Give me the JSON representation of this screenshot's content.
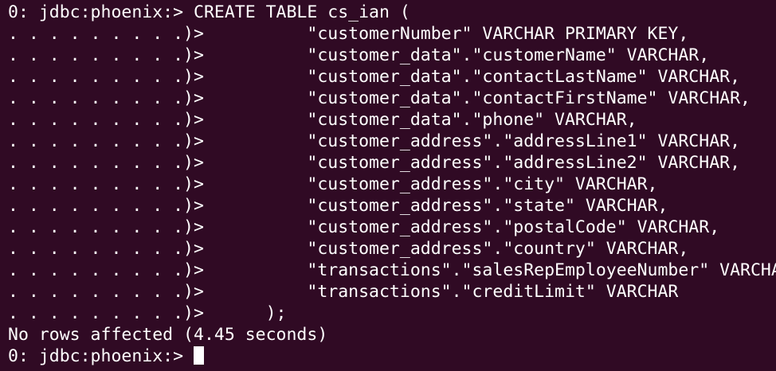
{
  "theme": {
    "background": "#300a24",
    "foreground": "#ffffff"
  },
  "terminal": {
    "lines": [
      "0: jdbc:phoenix:> CREATE TABLE cs_ian (",
      ". . . . . . . . .)>          \"customerNumber\" VARCHAR PRIMARY KEY,",
      ". . . . . . . . .)>          \"customer_data\".\"customerName\" VARCHAR,",
      ". . . . . . . . .)>          \"customer_data\".\"contactLastName\" VARCHAR,",
      ". . . . . . . . .)>          \"customer_data\".\"contactFirstName\" VARCHAR,",
      ". . . . . . . . .)>          \"customer_data\".\"phone\" VARCHAR,",
      ". . . . . . . . .)>          \"customer_address\".\"addressLine1\" VARCHAR,",
      ". . . . . . . . .)>          \"customer_address\".\"addressLine2\" VARCHAR,",
      ". . . . . . . . .)>          \"customer_address\".\"city\" VARCHAR,",
      ". . . . . . . . .)>          \"customer_address\".\"state\" VARCHAR,",
      ". . . . . . . . .)>          \"customer_address\".\"postalCode\" VARCHAR,",
      ". . . . . . . . .)>          \"customer_address\".\"country\" VARCHAR,",
      ". . . . . . . . .)>          \"transactions\".\"salesRepEmployeeNumber\" VARCHAR,",
      ". . . . . . . . .)>          \"transactions\".\"creditLimit\" VARCHAR",
      ". . . . . . . . .)>      );",
      "No rows affected (4.45 seconds)"
    ],
    "prompt": "0: jdbc:phoenix:> "
  }
}
